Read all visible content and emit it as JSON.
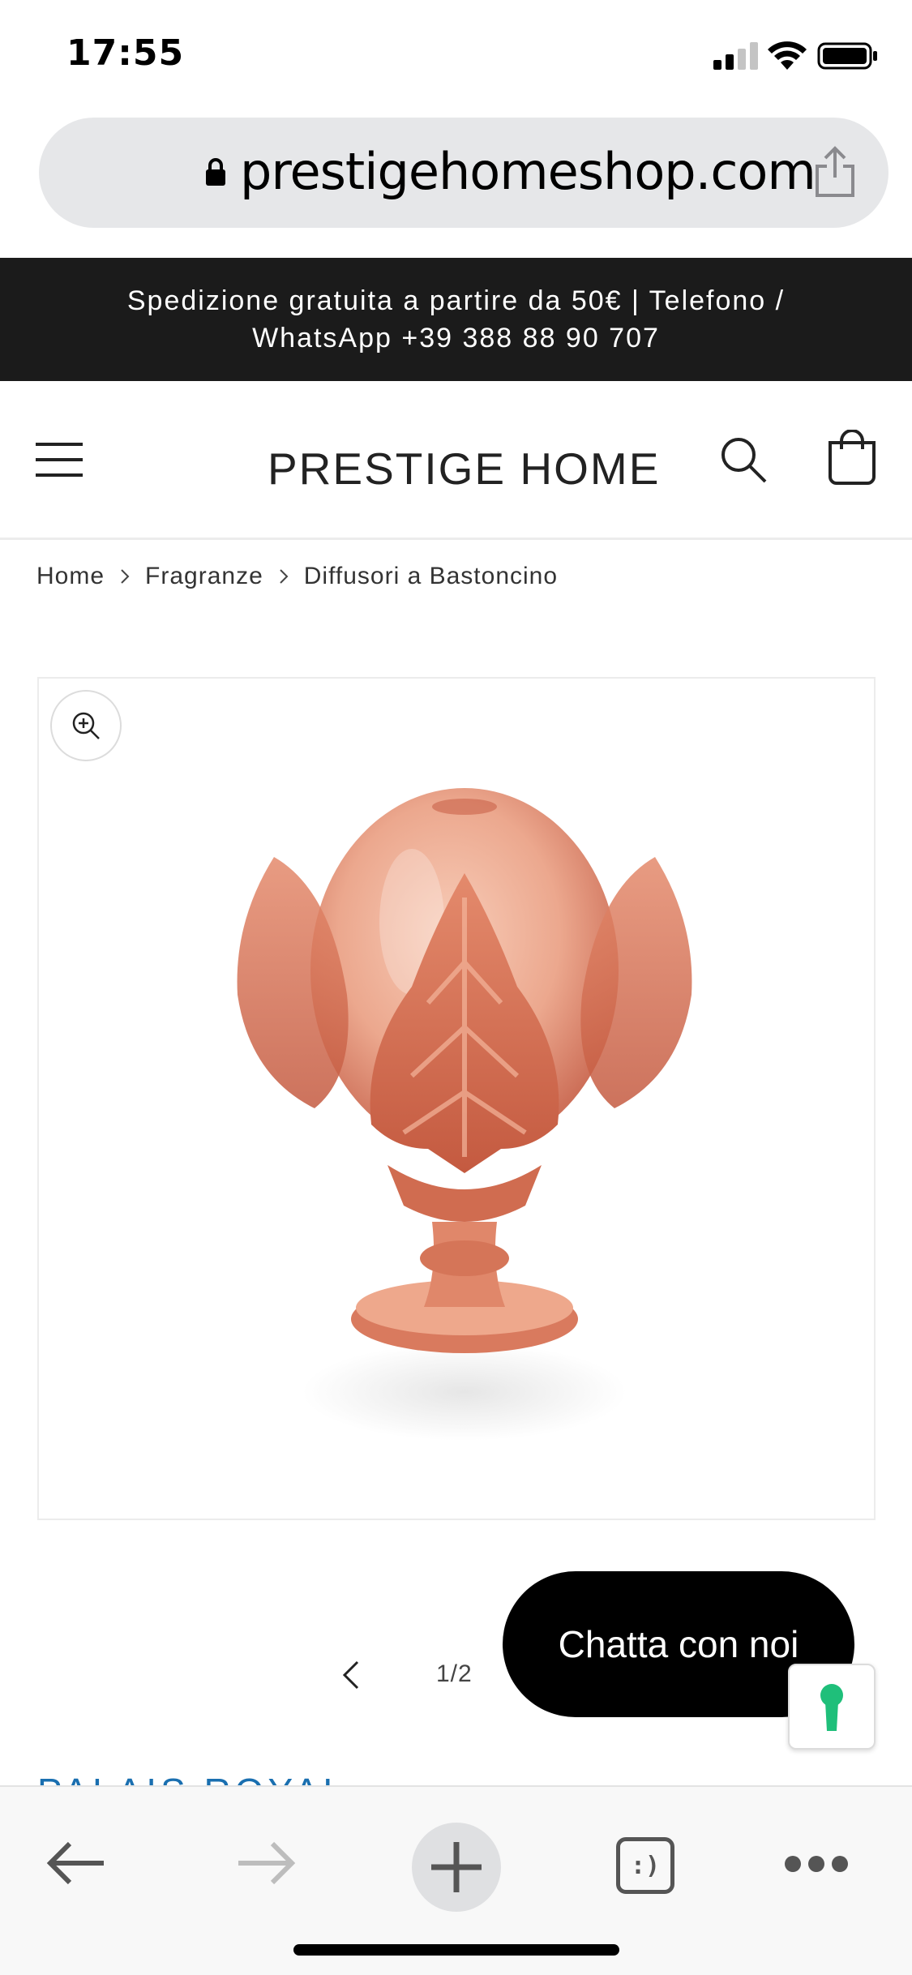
{
  "status_bar": {
    "time": "17:55",
    "icons": [
      "signal-icon",
      "wifi-icon",
      "battery-icon"
    ]
  },
  "browser": {
    "url": "prestigehomeshop.com",
    "icons": [
      "lock-icon",
      "share-icon"
    ]
  },
  "announcement": {
    "text": "Spedizione gratuita a partire da 50€ | Telefono / WhatsApp +39 388 88 90 707"
  },
  "header": {
    "logo": "PRESTIGE HOME",
    "icons": [
      "menu-icon",
      "search-icon",
      "cart-icon"
    ]
  },
  "breadcrumb": {
    "items": [
      "Home",
      "Fragranze",
      "Diffusori a Bastoncino"
    ]
  },
  "product": {
    "image_alt": "Pink glass pumo diffuser",
    "image_counter": "1/2",
    "vendor": "PALAIS ROYAL"
  },
  "chat": {
    "label": "Chatta con noi"
  },
  "toolbar": {
    "tabs_label": ":)",
    "icons": [
      "back-arrow-icon",
      "forward-arrow-icon",
      "plus-icon",
      "tabs-icon",
      "more-icon"
    ]
  },
  "colors": {
    "announcement_bg": "#1b1b1b",
    "chat_bg": "#000000",
    "vendor_link": "#1a6fb0",
    "product_glass": "#e08a6a"
  }
}
